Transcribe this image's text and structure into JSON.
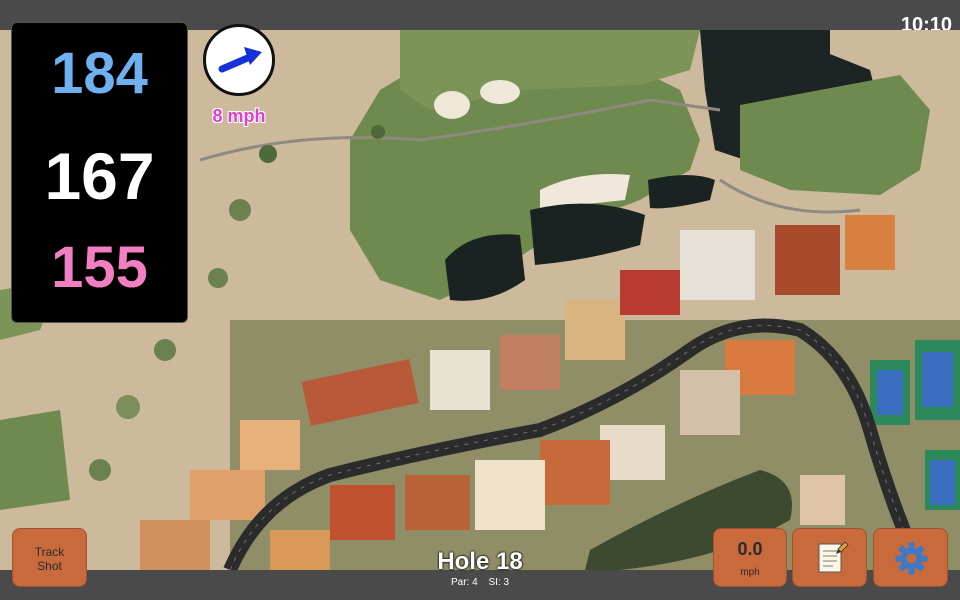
{
  "status_bar": {
    "time": "10:10"
  },
  "distances": {
    "back": "184",
    "middle": "167",
    "front": "155"
  },
  "colors": {
    "back": "#6fb0f0",
    "middle": "#ffffff",
    "front": "#f27fc2",
    "button": "#c96a3d",
    "wind_arrow": "#1432d8",
    "wind_text": "#e040c8"
  },
  "wind": {
    "speed_label": "8 mph",
    "arrow_icon": "arrow-up-right-icon"
  },
  "track_shot": {
    "line1": "Track",
    "line2": "Shot"
  },
  "wind_button": {
    "value": "0.0",
    "unit": "mph"
  },
  "notes_button": {
    "icon": "notepad-icon"
  },
  "settings_button": {
    "icon": "gear-icon"
  },
  "hole": {
    "title": "Hole 18",
    "par": "Par: 4",
    "si": "SI: 3"
  }
}
